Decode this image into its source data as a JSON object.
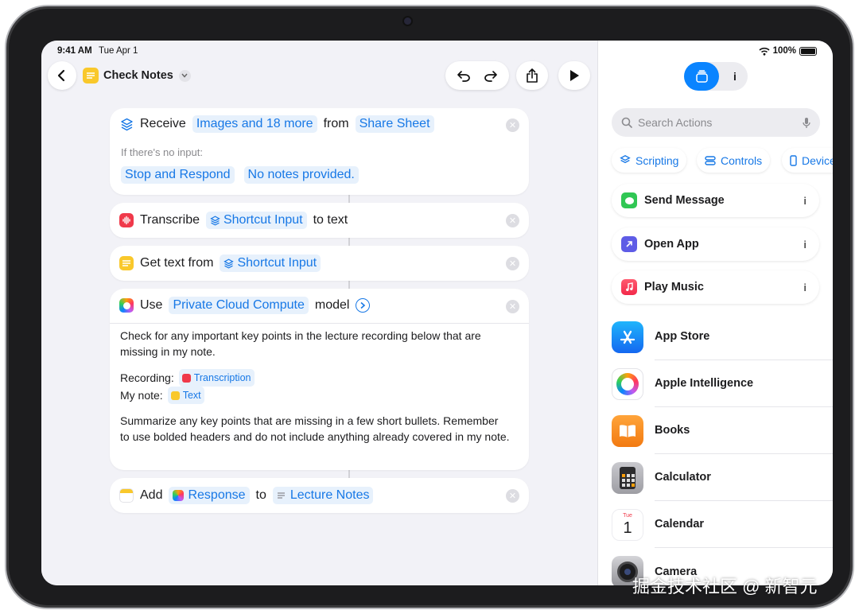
{
  "status": {
    "time": "9:41 AM",
    "date": "Tue Apr 1",
    "battery": "100%"
  },
  "header": {
    "title": "Check Notes",
    "back_icon": "chevron-left-icon",
    "undo_icon": "undo-icon",
    "redo_icon": "redo-icon",
    "share_icon": "share-icon",
    "run_icon": "play-icon"
  },
  "workflow": {
    "receive": {
      "label": "Receive",
      "input_types": "Images and 18 more",
      "from": "from",
      "source": "Share Sheet",
      "no_input_label": "If there's no input:",
      "action": "Stop and Respond",
      "message": "No notes provided."
    },
    "transcribe": {
      "label": "Transcribe",
      "input": "Shortcut Input",
      "suffix": "to text"
    },
    "get_text": {
      "label": "Get text from",
      "input": "Shortcut Input"
    },
    "model": {
      "label": "Use",
      "model_name": "Private Cloud Compute",
      "suffix": "model",
      "prompt_line1": "Check for any important key points in the lecture recording below that are missing in my note.",
      "recording_label": "Recording:",
      "recording_token": "Transcription",
      "note_label": "My note:",
      "note_token": "Text",
      "prompt_line2": "Summarize any key points that are missing in a few short bullets. Remember to use bolded headers and do not include anything already covered in my note."
    },
    "add": {
      "label": "Add",
      "token": "Response",
      "to": "to",
      "target": "Lecture Notes"
    }
  },
  "sidebar": {
    "search_placeholder": "Search Actions",
    "tabs": [
      {
        "icon": "library-icon",
        "active": true
      },
      {
        "icon": "info-icon",
        "label": "i",
        "active": false
      }
    ],
    "categories": [
      "Scripting",
      "Controls",
      "Device"
    ],
    "suggestions": [
      {
        "label": "Send Message",
        "info": "i"
      },
      {
        "label": "Open App",
        "info": "i"
      },
      {
        "label": "Play Music",
        "info": "i"
      }
    ],
    "apps": [
      {
        "name": "App Store"
      },
      {
        "name": "Apple Intelligence"
      },
      {
        "name": "Books"
      },
      {
        "name": "Calculator"
      },
      {
        "name": "Calendar",
        "icon_month": "Tue",
        "icon_day": "1"
      },
      {
        "name": "Camera"
      }
    ]
  },
  "colors": {
    "accent": "#1778e6",
    "token_bg": "#e7f1fc",
    "background": "#f2f2f7"
  },
  "watermark": "掘金技术社区 @ 新智元"
}
